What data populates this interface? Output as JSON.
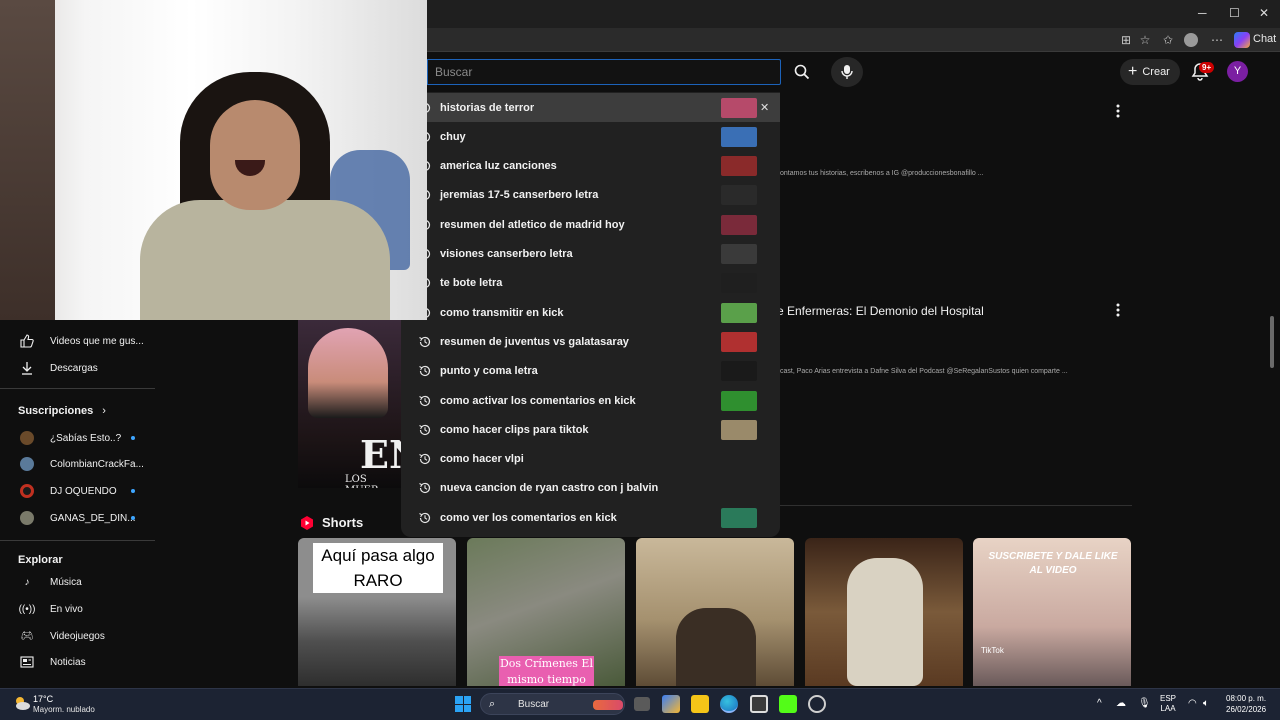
{
  "browser": {
    "window_controls": {
      "minimize": "─",
      "maximize": "☐",
      "close": "✕"
    },
    "copilot_label": "Chat"
  },
  "header": {
    "search_placeholder": "Buscar",
    "create_label": "Crear",
    "notifications_badge": "9+",
    "avatar_initial": "Y"
  },
  "suggestions": [
    {
      "text": "historias de terror",
      "removable": true,
      "thumb_color": "#b64a6a"
    },
    {
      "text": "chuy",
      "thumb_color": "#3a6fb5"
    },
    {
      "text": "america luz canciones",
      "thumb_color": "#8a2a2a"
    },
    {
      "text": "jeremias 17-5 canserbero letra",
      "thumb_color": "#2a2a2a"
    },
    {
      "text": "resumen del atletico de madrid hoy",
      "thumb_color": "#7a2a3a"
    },
    {
      "text": "visiones canserbero letra",
      "thumb_color": "#3a3a3a"
    },
    {
      "text": "te bote letra",
      "thumb_color": "#1f1f1f"
    },
    {
      "text": "como transmitir en kick",
      "thumb_color": "#5aa04a"
    },
    {
      "text": "resumen de juventus vs galatasaray",
      "thumb_color": "#b03030"
    },
    {
      "text": "punto y coma letra",
      "thumb_color": "#1a1a1a"
    },
    {
      "text": "como activar los comentarios en kick",
      "thumb_color": "#2f8f2f"
    },
    {
      "text": "como hacer clips para tiktok",
      "thumb_color": "#9a8a6a"
    },
    {
      "text": "como hacer vlpi",
      "thumb_color": ""
    },
    {
      "text": "nueva cancion de ryan castro con j balvin",
      "thumb_color": ""
    },
    {
      "text": "como ver los comentarios en kick",
      "thumb_color": "#2a7a5a"
    }
  ],
  "sidebar": {
    "you_items": [
      {
        "label": "Videos que me gus...",
        "icon": "thumbs-up-icon"
      },
      {
        "label": "Descargas",
        "icon": "download-icon"
      }
    ],
    "subscriptions_title": "Suscripciones",
    "subscriptions": [
      {
        "label": "¿Sabías Esto..?",
        "avatar_color": "#6a4a2a",
        "live": true
      },
      {
        "label": "ColombianCrackFa...",
        "avatar_color": "#5a7a9a",
        "live": false
      },
      {
        "label": "DJ OQUENDO",
        "avatar_color": "#c03020",
        "live": true
      },
      {
        "label": "GANAS_DE_DIN...",
        "avatar_color": "#7a7a6a",
        "live": true
      }
    ],
    "explore_title": "Explorar",
    "explore": [
      {
        "label": "Música",
        "icon": "music-note-icon"
      },
      {
        "label": "En vivo",
        "icon": "live-icon"
      },
      {
        "label": "Videojuegos",
        "icon": "gamepad-icon"
      },
      {
        "label": "Noticias",
        "icon": "news-icon"
      }
    ]
  },
  "main": {
    "snippet_1": "ontamos tus historias, escribenos a IG @produccionesbonafillo ...",
    "video_title_2": "e Enfermeras: El Demonio del Hospital",
    "snippet_2": "cast, Paco Arias entrevista a Dafne Silva del Podcast @SeRegalanSustos quien comparte ...",
    "left_thumb_big": "EN",
    "left_thumb_small": "LOS MUER"
  },
  "shorts": {
    "title": "Shorts",
    "items": [
      {
        "caption": "Aquí pasa algo RARO"
      },
      {
        "caption": "Dos Crímenes El mismo tiempo"
      },
      {
        "caption": ""
      },
      {
        "caption": ""
      },
      {
        "caption": "SUSCRIBETE Y DALE LIKE AL VIDEO",
        "watermark": "TikTok"
      }
    ]
  },
  "taskbar": {
    "weather_temp": "17°C",
    "weather_desc": "Mayorm. nublado",
    "search_label": "Buscar",
    "lang_1": "ESP",
    "lang_2": "LAA",
    "time": "08:00 p. m.",
    "date": "26/02/2026"
  }
}
